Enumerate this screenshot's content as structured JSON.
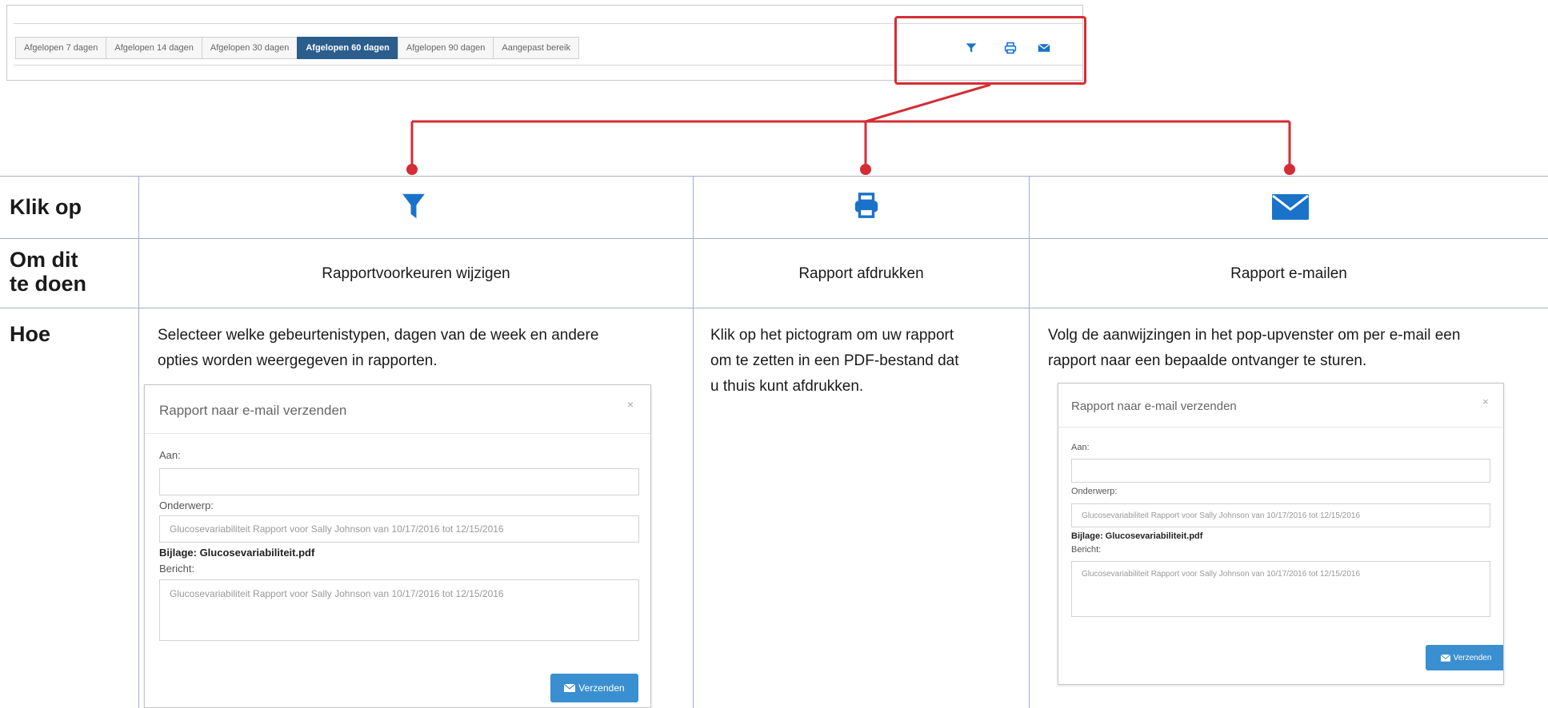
{
  "toolbar": {
    "range_tabs": [
      {
        "label": "Afgelopen 7 dagen"
      },
      {
        "label": "Afgelopen 14 dagen"
      },
      {
        "label": "Afgelopen 30 dagen"
      },
      {
        "label": "Afgelopen 60 dagen",
        "active": true
      },
      {
        "label": "Afgelopen 90 dagen"
      },
      {
        "label": "Aangepast bereik"
      }
    ],
    "icons": [
      "filter-icon",
      "print-icon",
      "mail-icon"
    ]
  },
  "colors": {
    "accent_blue": "#1a73c9",
    "highlight_red": "#d42d35",
    "active_tab": "#2b5d8d",
    "send_button": "#3a8fd0"
  },
  "table": {
    "row_labels": {
      "click": "Klik op",
      "purpose_line1": "Om dit",
      "purpose_line2": "te doen",
      "how": "Hoe"
    },
    "columns": [
      {
        "icon": "filter-icon",
        "purpose": "Rapportvoorkeuren wijzigen",
        "how_line1": "Selecteer welke gebeurtenistypen, dagen van de week en andere",
        "how_line2": "opties worden weergegeven in rapporten."
      },
      {
        "icon": "print-icon",
        "purpose": "Rapport afdrukken",
        "how_line1": "Klik op het pictogram om uw rapport",
        "how_line2": "om te zetten in een PDF-bestand dat",
        "how_line3": "u thuis kunt afdrukken."
      },
      {
        "icon": "mail-icon",
        "purpose": "Rapport e-mailen",
        "how_line1": "Volg de aanwijzingen in het pop-upvenster om per e-mail een",
        "how_line2": "rapport naar een bepaalde ontvanger te sturen."
      }
    ]
  },
  "dialog": {
    "title": "Rapport naar e-mail verzenden",
    "close": "×",
    "to_label": "Aan:",
    "to_value": "",
    "subject_label": "Onderwerp:",
    "subject_value": "Glucosevariabiliteit Rapport voor Sally Johnson van 10/17/2016 tot 12/15/2016",
    "attachment": "Bijlage: Glucosevariabiliteit.pdf",
    "message_label": "Bericht:",
    "message_value": "Glucosevariabiliteit Rapport voor Sally Johnson van 10/17/2016 tot 12/15/2016",
    "send_label": "Verzenden"
  }
}
